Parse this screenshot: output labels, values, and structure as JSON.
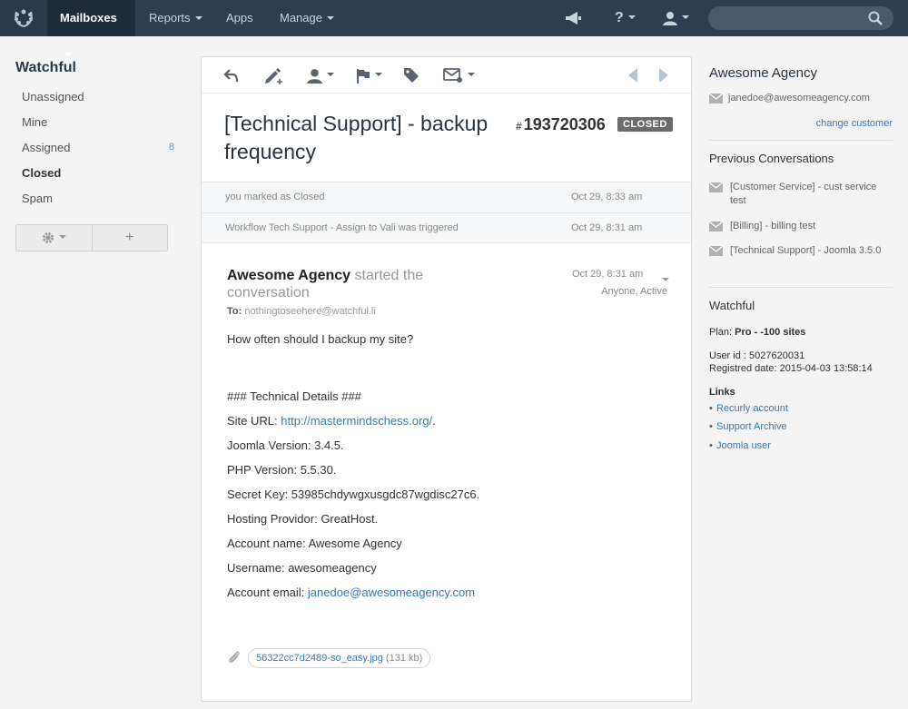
{
  "nav": {
    "items": [
      {
        "label": "Mailboxes"
      },
      {
        "label": "Reports"
      },
      {
        "label": "Apps"
      },
      {
        "label": "Manage"
      }
    ],
    "search_placeholder": ""
  },
  "sidebar": {
    "title": "Watchful",
    "folders": [
      {
        "label": "Unassigned",
        "count": ""
      },
      {
        "label": "Mine",
        "count": ""
      },
      {
        "label": "Assigned",
        "count": "8"
      },
      {
        "label": "Closed",
        "count": ""
      },
      {
        "label": "Spam",
        "count": ""
      }
    ],
    "active_folder": "Closed",
    "add_symbol": "+"
  },
  "conversation": {
    "subject_line1": "[Technical Support] - backup",
    "subject_line2": "frequency",
    "number_hash": "#",
    "number": "193720306",
    "status": "CLOSED",
    "events": [
      {
        "text": "you marked as Closed",
        "time": "Oct 29, 8:33 am"
      },
      {
        "text": "Workflow Tech Support - Assign to Vali was triggered",
        "time": "Oct 29, 8:31 am"
      }
    ],
    "thread": {
      "author": "Awesome Agency",
      "verb": "started the conversation",
      "time": "Oct 29, 8:31 am",
      "assignee_status": "Anyone, Active",
      "to_label": "To:",
      "to_email": "nothingtoseehere@watchful.li",
      "question": "How often should I backup my site?",
      "details_header": "### Technical Details ###",
      "site_url_label": "Site URL:",
      "site_url": "http://mastermindschess.org/",
      "site_url_suffix": ".",
      "joomla_version": "Joomla Version: 3.4.5.",
      "php_version": "PHP Version: 5.5.30.",
      "secret_key": "Secret Key: 53985chdywgxusgdc87wgdisc27c6.",
      "hosting": "Hosting Providor: GreatHost.",
      "account_name": "Account name: Awesome Agency",
      "username": "Username: awesomeagency",
      "account_email_label": "Account email:",
      "account_email": "janedoe@awesomeagency.com"
    },
    "attachment": {
      "name": "56322cc7d2489-so_easy.jpg",
      "size": "(131 kb)"
    }
  },
  "customer": {
    "name": "Awesome Agency",
    "email": "janedoe@awesomeagency.com",
    "change_label": "change customer",
    "previous_title": "Previous Conversations",
    "previous": [
      {
        "title": "[Customer Service] - cust service test"
      },
      {
        "title": "[Billing] - billing test"
      },
      {
        "title": "[Technical Support] - Joomla 3.5.0"
      }
    ],
    "app_title": "Watchful",
    "plan_label": "Plan:",
    "plan_value": "Pro - -100 sites",
    "user_id": "User id : 5027620031",
    "registered": "Registred date: 2015-04-03 13:58:14",
    "links_title": "Links",
    "links": [
      {
        "label": "Recurly account"
      },
      {
        "label": "Support Archive"
      },
      {
        "label": "Joomla user"
      }
    ]
  },
  "colors": {
    "nav_bg": "#2e3e4f",
    "nav_active": "#1e2c3a",
    "link": "#3a78b5",
    "badge": "#6b6b6b"
  }
}
